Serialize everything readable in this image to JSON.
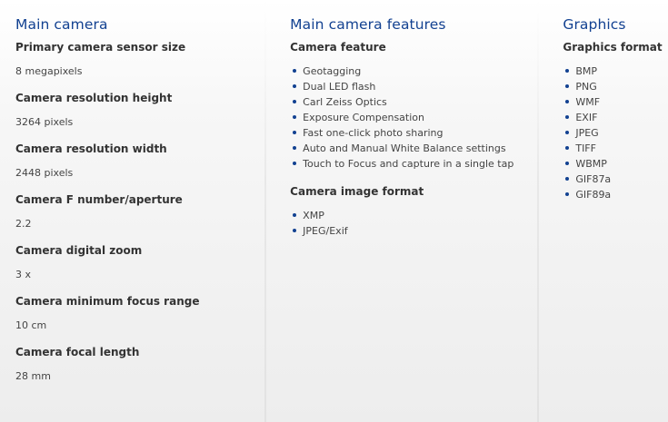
{
  "columns": {
    "camera": {
      "title": "Main camera",
      "specs": [
        {
          "label": "Primary camera sensor size",
          "value": "8 megapixels"
        },
        {
          "label": "Camera resolution height",
          "value": "3264 pixels"
        },
        {
          "label": "Camera resolution width",
          "value": "2448 pixels"
        },
        {
          "label": "Camera F number/aperture",
          "value": "2.2"
        },
        {
          "label": "Camera digital zoom",
          "value": "3 x"
        },
        {
          "label": "Camera minimum focus range",
          "value": "10 cm"
        },
        {
          "label": "Camera focal length",
          "value": "28 mm"
        }
      ]
    },
    "features": {
      "title": "Main camera features",
      "groups": [
        {
          "heading": "Camera feature",
          "items": [
            "Geotagging",
            "Dual LED flash",
            "Carl Zeiss Optics",
            "Exposure Compensation",
            "Fast one-click photo sharing",
            "Auto and Manual White Balance settings",
            "Touch to Focus and capture in a single tap"
          ]
        },
        {
          "heading": "Camera image format",
          "items": [
            "XMP",
            "JPEG/Exif"
          ]
        }
      ]
    },
    "graphics": {
      "title": "Graphics",
      "groups": [
        {
          "heading": "Graphics format",
          "items": [
            "BMP",
            "PNG",
            "WMF",
            "EXIF",
            "JPEG",
            "TIFF",
            "WBMP",
            "GIF87a",
            "GIF89a"
          ]
        }
      ]
    }
  },
  "colors": {
    "heading_blue": "#124191",
    "text_dark": "#333333",
    "bullet": "#124191"
  }
}
